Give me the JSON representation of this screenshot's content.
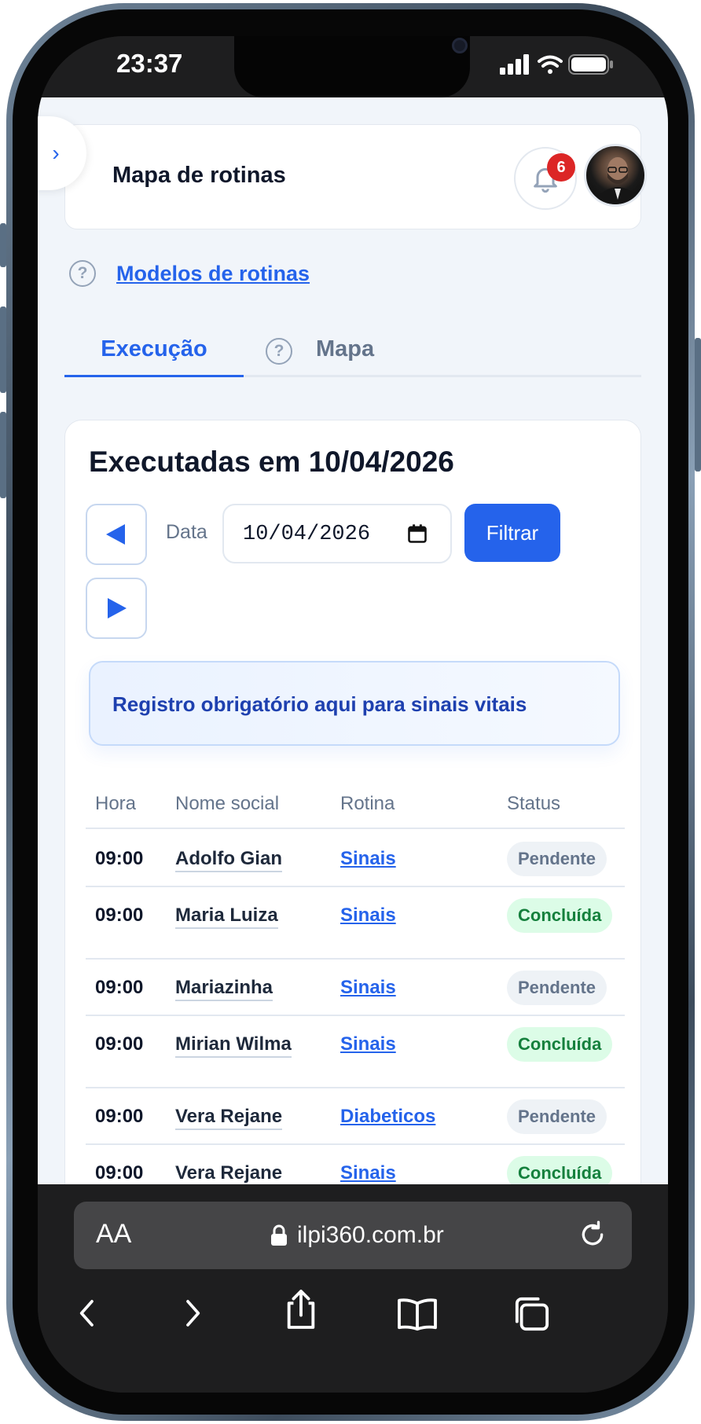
{
  "status_bar": {
    "time": "23:37"
  },
  "header": {
    "title": "Mapa de rotinas",
    "notification_count": "6"
  },
  "help_link": "Modelos de rotinas",
  "tabs": [
    {
      "label": "Execução",
      "active": true
    },
    {
      "label": "Mapa",
      "active": false
    }
  ],
  "card": {
    "title": "Executadas em 10/04/2026",
    "date_label": "Data",
    "date_value": "10/04/2026",
    "filter_label": "Filtrar",
    "notice": "Registro obrigatório aqui para sinais vitais"
  },
  "table": {
    "headers": [
      "Hora",
      "Nome social",
      "Rotina",
      "Status"
    ],
    "rows": [
      {
        "hora": "09:00",
        "nome": "Adolfo Gian",
        "rotina": "Sinais",
        "status": "Pendente"
      },
      {
        "hora": "09:00",
        "nome": "Maria Luiza",
        "rotina": "Sinais",
        "status": "Concluída"
      },
      {
        "hora": "09:00",
        "nome": "Mariazinha",
        "rotina": "Sinais",
        "status": "Pendente"
      },
      {
        "hora": "09:00",
        "nome": "Mirian Wilma",
        "rotina": "Sinais",
        "status": "Concluída"
      },
      {
        "hora": "09:00",
        "nome": "Vera Rejane",
        "rotina": "Diabeticos",
        "status": "Pendente"
      },
      {
        "hora": "09:00",
        "nome": "Vera Rejane",
        "rotina": "Sinais",
        "status": "Concluída"
      }
    ]
  },
  "browser": {
    "text_size_label": "AA",
    "url": "ilpi360.com.br"
  },
  "colors": {
    "accent": "#2563eb",
    "pending_bg": "#eef2f6",
    "done_bg": "#dcfce7",
    "done_text": "#15803d"
  }
}
